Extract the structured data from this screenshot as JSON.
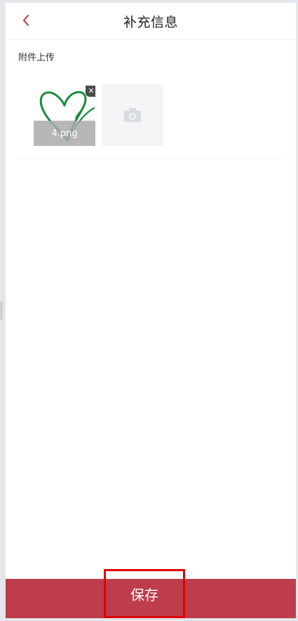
{
  "header": {
    "title": "补充信息"
  },
  "section": {
    "label": "附件上传"
  },
  "uploads": [
    {
      "file_name": "4.png",
      "icon": "heart-vine-icon",
      "remove_icon": "close-icon"
    }
  ],
  "add_tile": {
    "icon": "camera-icon"
  },
  "footer": {
    "save_label": "保存"
  },
  "colors": {
    "accent": "#bd3d4a",
    "highlight": "#e00000",
    "back": "#c0392b",
    "heart": "#1a8a3c"
  }
}
